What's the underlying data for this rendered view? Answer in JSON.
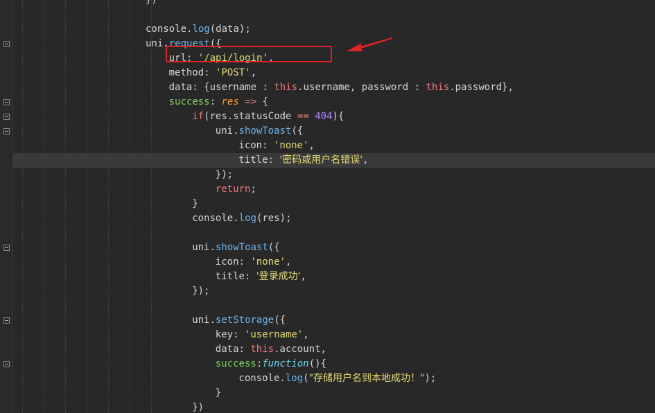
{
  "colors": {
    "background": "#282828",
    "active_line": "#3a3a3a",
    "annotation": "#e02424"
  },
  "code": {
    "lines": [
      {
        "tokens": [
          {
            "t": "})",
            "c": "t"
          }
        ]
      },
      {
        "tokens": []
      },
      {
        "tokens": [
          {
            "t": "console",
            "c": "t"
          },
          {
            "t": ".",
            "c": "t"
          },
          {
            "t": "log",
            "c": "fn"
          },
          {
            "t": "(data);",
            "c": "t"
          }
        ]
      },
      {
        "tokens": [
          {
            "t": "uni",
            "c": "t"
          },
          {
            "t": ".",
            "c": "t"
          },
          {
            "t": "request",
            "c": "fn"
          },
          {
            "t": "({",
            "c": "t"
          }
        ]
      },
      {
        "tokens": [
          {
            "t": "url",
            "c": "t"
          },
          {
            "t": ": ",
            "c": "t"
          },
          {
            "t": "'/api/login'",
            "c": "str"
          },
          {
            "t": ",",
            "c": "t"
          }
        ]
      },
      {
        "tokens": [
          {
            "t": "method",
            "c": "t"
          },
          {
            "t": ": ",
            "c": "t"
          },
          {
            "t": "'POST'",
            "c": "str"
          },
          {
            "t": ",",
            "c": "t"
          }
        ]
      },
      {
        "tokens": [
          {
            "t": "data",
            "c": "t"
          },
          {
            "t": ": {username : ",
            "c": "t"
          },
          {
            "t": "this",
            "c": "kw"
          },
          {
            "t": ".username, password : ",
            "c": "t"
          },
          {
            "t": "this",
            "c": "kw"
          },
          {
            "t": ".password},",
            "c": "t"
          }
        ]
      },
      {
        "tokens": [
          {
            "t": "success",
            "c": "prop"
          },
          {
            "t": ": ",
            "c": "t"
          },
          {
            "t": "res",
            "c": "param"
          },
          {
            "t": " ",
            "c": "t"
          },
          {
            "t": "=>",
            "c": "op"
          },
          {
            "t": " {",
            "c": "t"
          }
        ]
      },
      {
        "tokens": [
          {
            "t": "if",
            "c": "kw"
          },
          {
            "t": "(res.statusCode ",
            "c": "t"
          },
          {
            "t": "==",
            "c": "op"
          },
          {
            "t": " ",
            "c": "t"
          },
          {
            "t": "404",
            "c": "num"
          },
          {
            "t": "){",
            "c": "t"
          }
        ]
      },
      {
        "tokens": [
          {
            "t": "uni",
            "c": "t"
          },
          {
            "t": ".",
            "c": "t"
          },
          {
            "t": "showToast",
            "c": "fn"
          },
          {
            "t": "({",
            "c": "t"
          }
        ]
      },
      {
        "tokens": [
          {
            "t": "icon",
            "c": "t"
          },
          {
            "t": ": ",
            "c": "t"
          },
          {
            "t": "'none'",
            "c": "str"
          },
          {
            "t": ",",
            "c": "t"
          }
        ]
      },
      {
        "tokens": [
          {
            "t": "title",
            "c": "t"
          },
          {
            "t": ": ",
            "c": "t"
          },
          {
            "t": "'密码或用户名错误'",
            "c": "str"
          },
          {
            "t": ",",
            "c": "t"
          }
        ]
      },
      {
        "tokens": [
          {
            "t": "});",
            "c": "t"
          }
        ]
      },
      {
        "tokens": [
          {
            "t": "return",
            "c": "kw"
          },
          {
            "t": ";",
            "c": "t"
          }
        ]
      },
      {
        "tokens": [
          {
            "t": "}",
            "c": "t"
          }
        ]
      },
      {
        "tokens": [
          {
            "t": "console",
            "c": "t"
          },
          {
            "t": ".",
            "c": "t"
          },
          {
            "t": "log",
            "c": "fn"
          },
          {
            "t": "(res);",
            "c": "t"
          }
        ]
      },
      {
        "tokens": []
      },
      {
        "tokens": [
          {
            "t": "uni",
            "c": "t"
          },
          {
            "t": ".",
            "c": "t"
          },
          {
            "t": "showToast",
            "c": "fn"
          },
          {
            "t": "({",
            "c": "t"
          }
        ]
      },
      {
        "tokens": [
          {
            "t": "icon",
            "c": "t"
          },
          {
            "t": ": ",
            "c": "t"
          },
          {
            "t": "'none'",
            "c": "str"
          },
          {
            "t": ",",
            "c": "t"
          }
        ]
      },
      {
        "tokens": [
          {
            "t": "title",
            "c": "t"
          },
          {
            "t": ": ",
            "c": "t"
          },
          {
            "t": "'登录成功'",
            "c": "str"
          },
          {
            "t": ",",
            "c": "t"
          }
        ]
      },
      {
        "tokens": [
          {
            "t": "});",
            "c": "t"
          }
        ]
      },
      {
        "tokens": []
      },
      {
        "tokens": [
          {
            "t": "uni",
            "c": "t"
          },
          {
            "t": ".",
            "c": "t"
          },
          {
            "t": "setStorage",
            "c": "fn"
          },
          {
            "t": "({",
            "c": "t"
          }
        ]
      },
      {
        "tokens": [
          {
            "t": "key",
            "c": "t"
          },
          {
            "t": ": ",
            "c": "t"
          },
          {
            "t": "'username'",
            "c": "str"
          },
          {
            "t": ",",
            "c": "t"
          }
        ]
      },
      {
        "tokens": [
          {
            "t": "data",
            "c": "t"
          },
          {
            "t": ": ",
            "c": "t"
          },
          {
            "t": "this",
            "c": "kw"
          },
          {
            "t": ".account,",
            "c": "t"
          }
        ]
      },
      {
        "tokens": [
          {
            "t": "success",
            "c": "prop"
          },
          {
            "t": ":",
            "c": "t"
          },
          {
            "t": "function",
            "c": "ital"
          },
          {
            "t": "(){",
            "c": "t"
          }
        ]
      },
      {
        "tokens": [
          {
            "t": "console",
            "c": "t"
          },
          {
            "t": ".",
            "c": "t"
          },
          {
            "t": "log",
            "c": "fn"
          },
          {
            "t": "(",
            "c": "t"
          },
          {
            "t": "\"存储用户名到本地成功！\"",
            "c": "str"
          },
          {
            "t": ");",
            "c": "t"
          }
        ]
      },
      {
        "tokens": [
          {
            "t": "}",
            "c": "t"
          }
        ]
      },
      {
        "tokens": [
          {
            "t": "})",
            "c": "t"
          }
        ]
      }
    ]
  }
}
